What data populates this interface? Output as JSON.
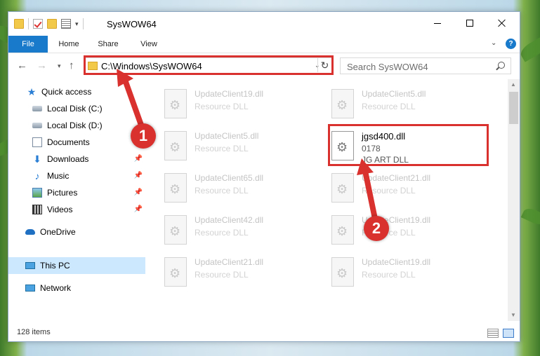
{
  "window": {
    "title": "SysWOW64",
    "minimize_glyph": "",
    "close_glyph": ""
  },
  "ribbon": {
    "tabs": [
      {
        "label": "File"
      },
      {
        "label": "Home"
      },
      {
        "label": "Share"
      },
      {
        "label": "View"
      }
    ],
    "help_glyph": "?"
  },
  "navbar": {
    "address": "C:\\Windows\\SysWOW64",
    "search_placeholder": "Search SysWOW64"
  },
  "sidebar": {
    "items": [
      {
        "label": "Quick access",
        "icon": "quick-access-star-icon"
      },
      {
        "label": "Local Disk (C:)",
        "icon": "drive-icon"
      },
      {
        "label": "Local Disk (D:)",
        "icon": "drive-icon"
      },
      {
        "label": "Documents",
        "icon": "documents-icon"
      },
      {
        "label": "Downloads",
        "icon": "downloads-icon",
        "pinned": true
      },
      {
        "label": "Music",
        "icon": "music-icon",
        "pinned": true
      },
      {
        "label": "Pictures",
        "icon": "pictures-icon",
        "pinned": true
      },
      {
        "label": "Videos",
        "icon": "videos-icon",
        "pinned": true
      },
      {
        "label": "OneDrive",
        "icon": "onedrive-icon"
      },
      {
        "label": "This PC",
        "icon": "this-pc-icon",
        "selected": true
      },
      {
        "label": "Network",
        "icon": "network-icon"
      }
    ]
  },
  "files": {
    "left": [
      {
        "name": "UpdateClient19.dll",
        "desc": "Resource DLL"
      },
      {
        "name": "UpdateClient5.dll",
        "desc": "Resource DLL"
      },
      {
        "name": "UpdateClient65.dll",
        "desc": "Resource DLL"
      },
      {
        "name": "UpdateClient42.dll",
        "desc": "Resource DLL"
      },
      {
        "name": "UpdateClient21.dll",
        "desc": "Resource DLL"
      }
    ],
    "right": [
      {
        "name": "UpdateClient5.dll",
        "desc": "Resource DLL"
      },
      {
        "name": "jgsd400.dll",
        "desc": "0178",
        "extra": "JG ART DLL"
      },
      {
        "name": "UpdateClient21.dll",
        "desc": "Resource DLL"
      },
      {
        "name": "UpdateClient19.dll",
        "desc": "Resource DLL"
      },
      {
        "name": "UpdateClient19.dll",
        "desc": "Resource DLL"
      }
    ]
  },
  "status": {
    "item_count": "128 items"
  },
  "callouts": {
    "step1": "1",
    "step2": "2"
  },
  "colors": {
    "accent": "#1979ca",
    "highlight_red": "#d9312e",
    "selected_bg": "#cce8ff"
  }
}
